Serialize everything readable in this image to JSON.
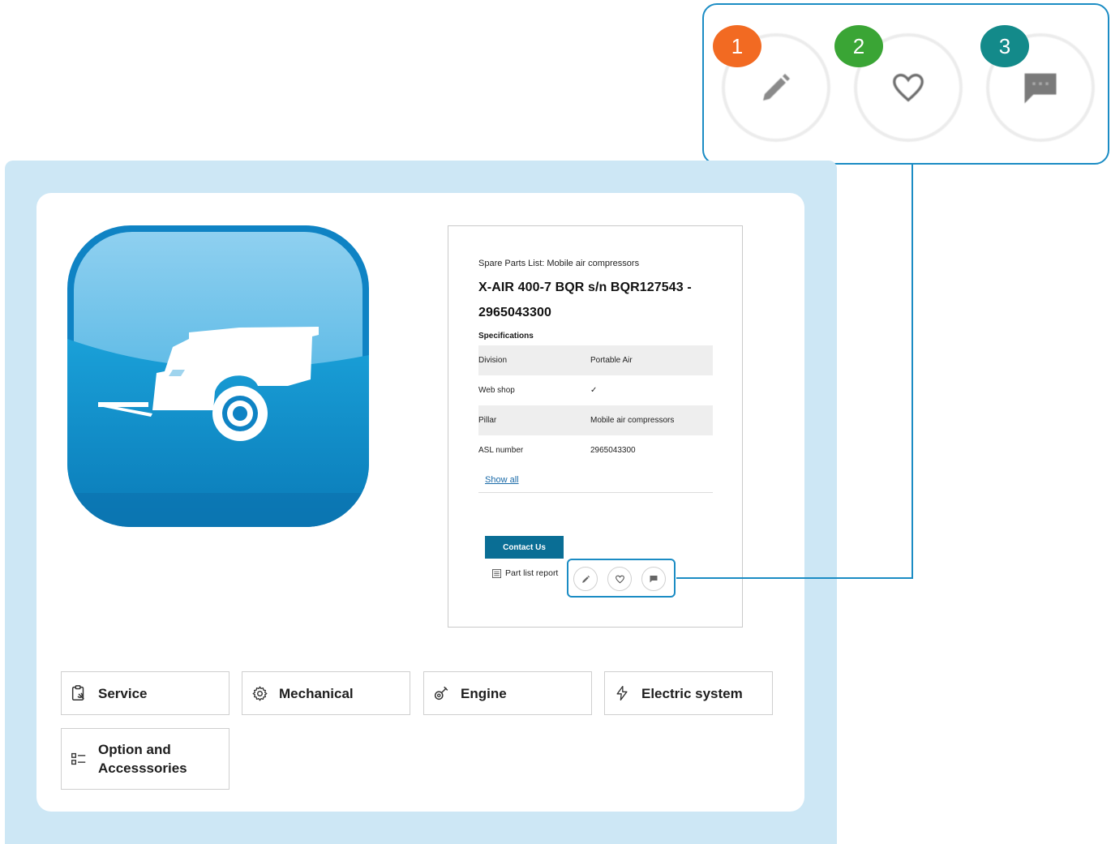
{
  "callout": {
    "badges": [
      {
        "number": "1",
        "color": "#f26a22"
      },
      {
        "number": "2",
        "color": "#3aa535"
      },
      {
        "number": "3",
        "color": "#138a8a"
      }
    ],
    "icons": [
      "pencil-icon",
      "heart-icon",
      "comment-icon"
    ]
  },
  "product": {
    "breadcrumb": "Spare Parts List: Mobile air compressors",
    "title_line1": "X-AIR 400-7 BQR s/n BQR127543 -",
    "title_line2": "2965043300",
    "specs_heading": "Specifications",
    "specs": [
      {
        "key": "Division",
        "value": "Portable Air"
      },
      {
        "key": "Web shop",
        "value": "✓"
      },
      {
        "key": "Pillar",
        "value": "Mobile air compressors"
      },
      {
        "key": "ASL number",
        "value": "2965043300"
      }
    ],
    "show_all": "Show all",
    "contact_button": "Contact Us",
    "report_link": "Part list report"
  },
  "categories": [
    {
      "label": "Service",
      "icon": "service-clipboard-icon"
    },
    {
      "label": "Mechanical",
      "icon": "gear-icon"
    },
    {
      "label": "Engine",
      "icon": "engine-icon"
    },
    {
      "label": "Electric system",
      "icon": "lightning-icon"
    },
    {
      "label_line1": "Option and",
      "label_line2": "Accesssories",
      "icon": "list-icon"
    }
  ],
  "colors": {
    "accent": "#1b8cc4",
    "panel_bg": "#cde7f5",
    "button": "#0a6e95"
  }
}
